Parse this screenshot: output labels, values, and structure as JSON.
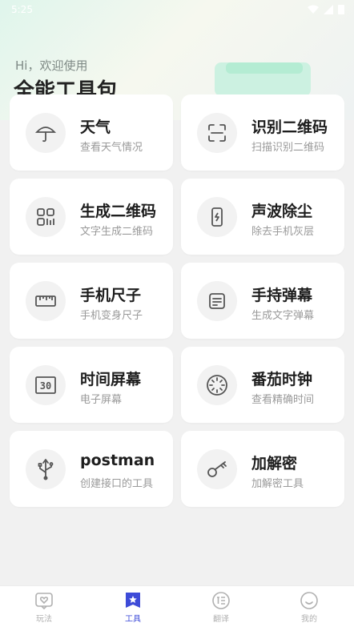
{
  "status_bar": {
    "time": "5:25"
  },
  "header": {
    "greeting": "Hi，欢迎使用",
    "title": "全能工具包"
  },
  "tools": [
    {
      "title": "天气",
      "subtitle": "查看天气情况",
      "icon": "umbrella-icon"
    },
    {
      "title": "识别二维码",
      "subtitle": "扫描识别二维码",
      "icon": "scan-icon"
    },
    {
      "title": "生成二维码",
      "subtitle": "文字生成二维码",
      "icon": "qrcode-icon"
    },
    {
      "title": "声波除尘",
      "subtitle": "除去手机灰层",
      "icon": "phone-bolt-icon"
    },
    {
      "title": "手机尺子",
      "subtitle": "手机变身尺子",
      "icon": "ruler-icon"
    },
    {
      "title": "手持弹幕",
      "subtitle": "生成文字弹幕",
      "icon": "text-card-icon"
    },
    {
      "title": "时间屏幕",
      "subtitle": "电子屏幕",
      "icon": "digital-30-icon"
    },
    {
      "title": "番茄时钟",
      "subtitle": "查看精确时间",
      "icon": "timer-icon"
    },
    {
      "title": "postman",
      "subtitle": "创建接口的工具",
      "icon": "usb-icon"
    },
    {
      "title": "加解密",
      "subtitle": "加解密工具",
      "icon": "key-icon"
    }
  ],
  "tabbar": {
    "tabs": [
      {
        "label": "玩法",
        "icon": "heart-chat-icon"
      },
      {
        "label": "工具",
        "icon": "star-bookmark-icon"
      },
      {
        "label": "翻译",
        "icon": "translate-icon"
      },
      {
        "label": "我的",
        "icon": "smile-icon"
      }
    ],
    "active_color": "#3d4bd8",
    "inactive_color": "#b0b0b0"
  },
  "digital_label": "30"
}
